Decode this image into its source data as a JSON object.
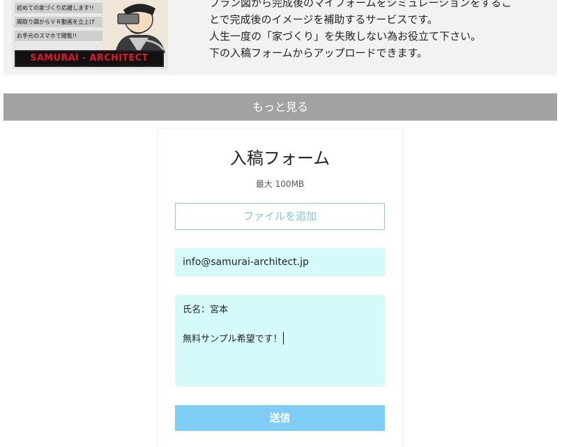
{
  "banner": {
    "tags": [
      "初めての家づくり応援します!!",
      "間取り図からＶＲ動画を立上げ",
      "お手元のスマホで閲覧!!"
    ],
    "logo": "SAMURAI - ARCHITECT"
  },
  "intro": {
    "lines": [
      "プラン図から完成後のマイフォームをシミュレーションをするこ",
      "とで完成後のイメージを補助するサービスです。",
      "人生一度の「家づくり」を失敗しない為お役立て下さい。",
      "下の入稿フォームからアップロードできます。"
    ]
  },
  "more_label": "もっと見る",
  "form": {
    "title": "入稿フォーム",
    "max_size": "最大 100MB",
    "add_file_label": "ファイルを追加",
    "email_value": "info@samurai-architect.jp",
    "message_lines": [
      "氏名：宮本",
      "",
      "無料サンプル希望です！"
    ],
    "submit_label": "送信"
  }
}
